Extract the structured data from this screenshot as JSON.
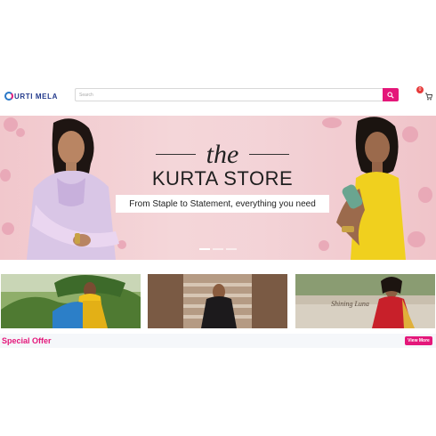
{
  "header": {
    "logo_text": "URTI MELA",
    "search_placeholder": "Search",
    "search_icon": "search-icon",
    "cart_icon": "cart-icon",
    "cart_count": "0"
  },
  "hero": {
    "title_the": "the",
    "title_store": "KURTA STORE",
    "tagline": "From Staple to Statement, everything you need",
    "slides": 3,
    "active_slide": 1
  },
  "thumbnails": [
    {
      "name": "yellow-saree"
    },
    {
      "name": "black-saree"
    },
    {
      "name": "red-saree",
      "caption": "Shining Luna"
    }
  ],
  "offer": {
    "title": "Special Offer",
    "view_more": "View More"
  },
  "colors": {
    "brand_pink": "#e4177a",
    "logo_blue": "#233a8c",
    "badge_red": "#e63a3a"
  }
}
